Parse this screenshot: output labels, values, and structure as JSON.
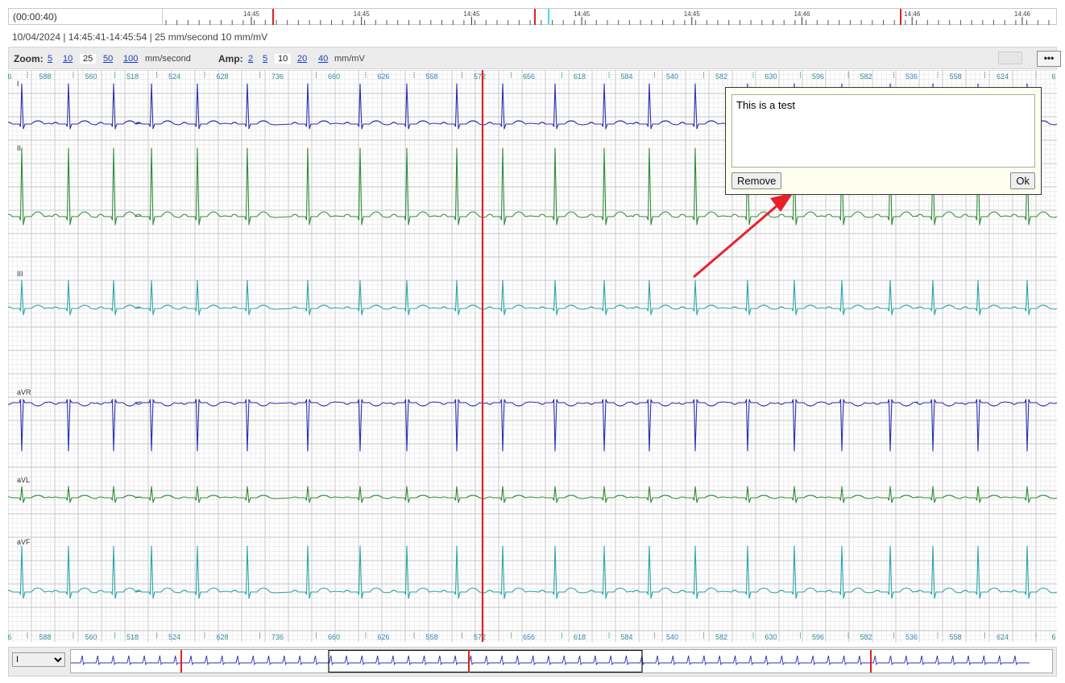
{
  "timeline": {
    "elapsed": "(00:00:40)",
    "tick_labels": [
      "14:45",
      "14:45",
      "14:45",
      "14:45",
      "14:45",
      "14:46",
      "14:46",
      "14:46"
    ]
  },
  "info_line": "10/04/2024 | 14:45:41-14:45:54 | 25 mm/second 10 mm/mV",
  "toolbar": {
    "zoom_label": "Zoom:",
    "zoom_options": [
      "5",
      "10",
      "25",
      "50",
      "100"
    ],
    "zoom_selected": "25",
    "zoom_unit": "mm/second",
    "amp_label": "Amp:",
    "amp_options": [
      "2",
      "5",
      "10",
      "20",
      "40"
    ],
    "amp_selected": "10",
    "amp_unit": "mm/mV",
    "more_label": "•••"
  },
  "rr_intervals": [
    "6",
    "588",
    "560",
    "518",
    "524",
    "628",
    "736",
    "660",
    "626",
    "558",
    "572",
    "656",
    "618",
    "584",
    "540",
    "582",
    "630",
    "596",
    "582",
    "536",
    "558",
    "624",
    "6"
  ],
  "leads": [
    {
      "name": "I",
      "color": "#2b2fb0"
    },
    {
      "name": "II",
      "color": "#2e8b3a"
    },
    {
      "name": "III",
      "color": "#2aa5a8"
    },
    {
      "name": "aVR",
      "color": "#2b2fb0"
    },
    {
      "name": "aVL",
      "color": "#2e8b3a"
    },
    {
      "name": "aVF",
      "color": "#2aa5a8"
    }
  ],
  "annotation": {
    "text": "This is a test",
    "remove_label": "Remove",
    "ok_label": "Ok"
  },
  "overview": {
    "selected_lead": "I"
  },
  "colors": {
    "cursor": "#e02020",
    "marker_cyan": "#4fd8e8",
    "grid_minor": "#e6e6e6",
    "grid_major": "#c4c4c4",
    "arrow": "#e8202a",
    "rr_text": "#3a8a9a"
  }
}
